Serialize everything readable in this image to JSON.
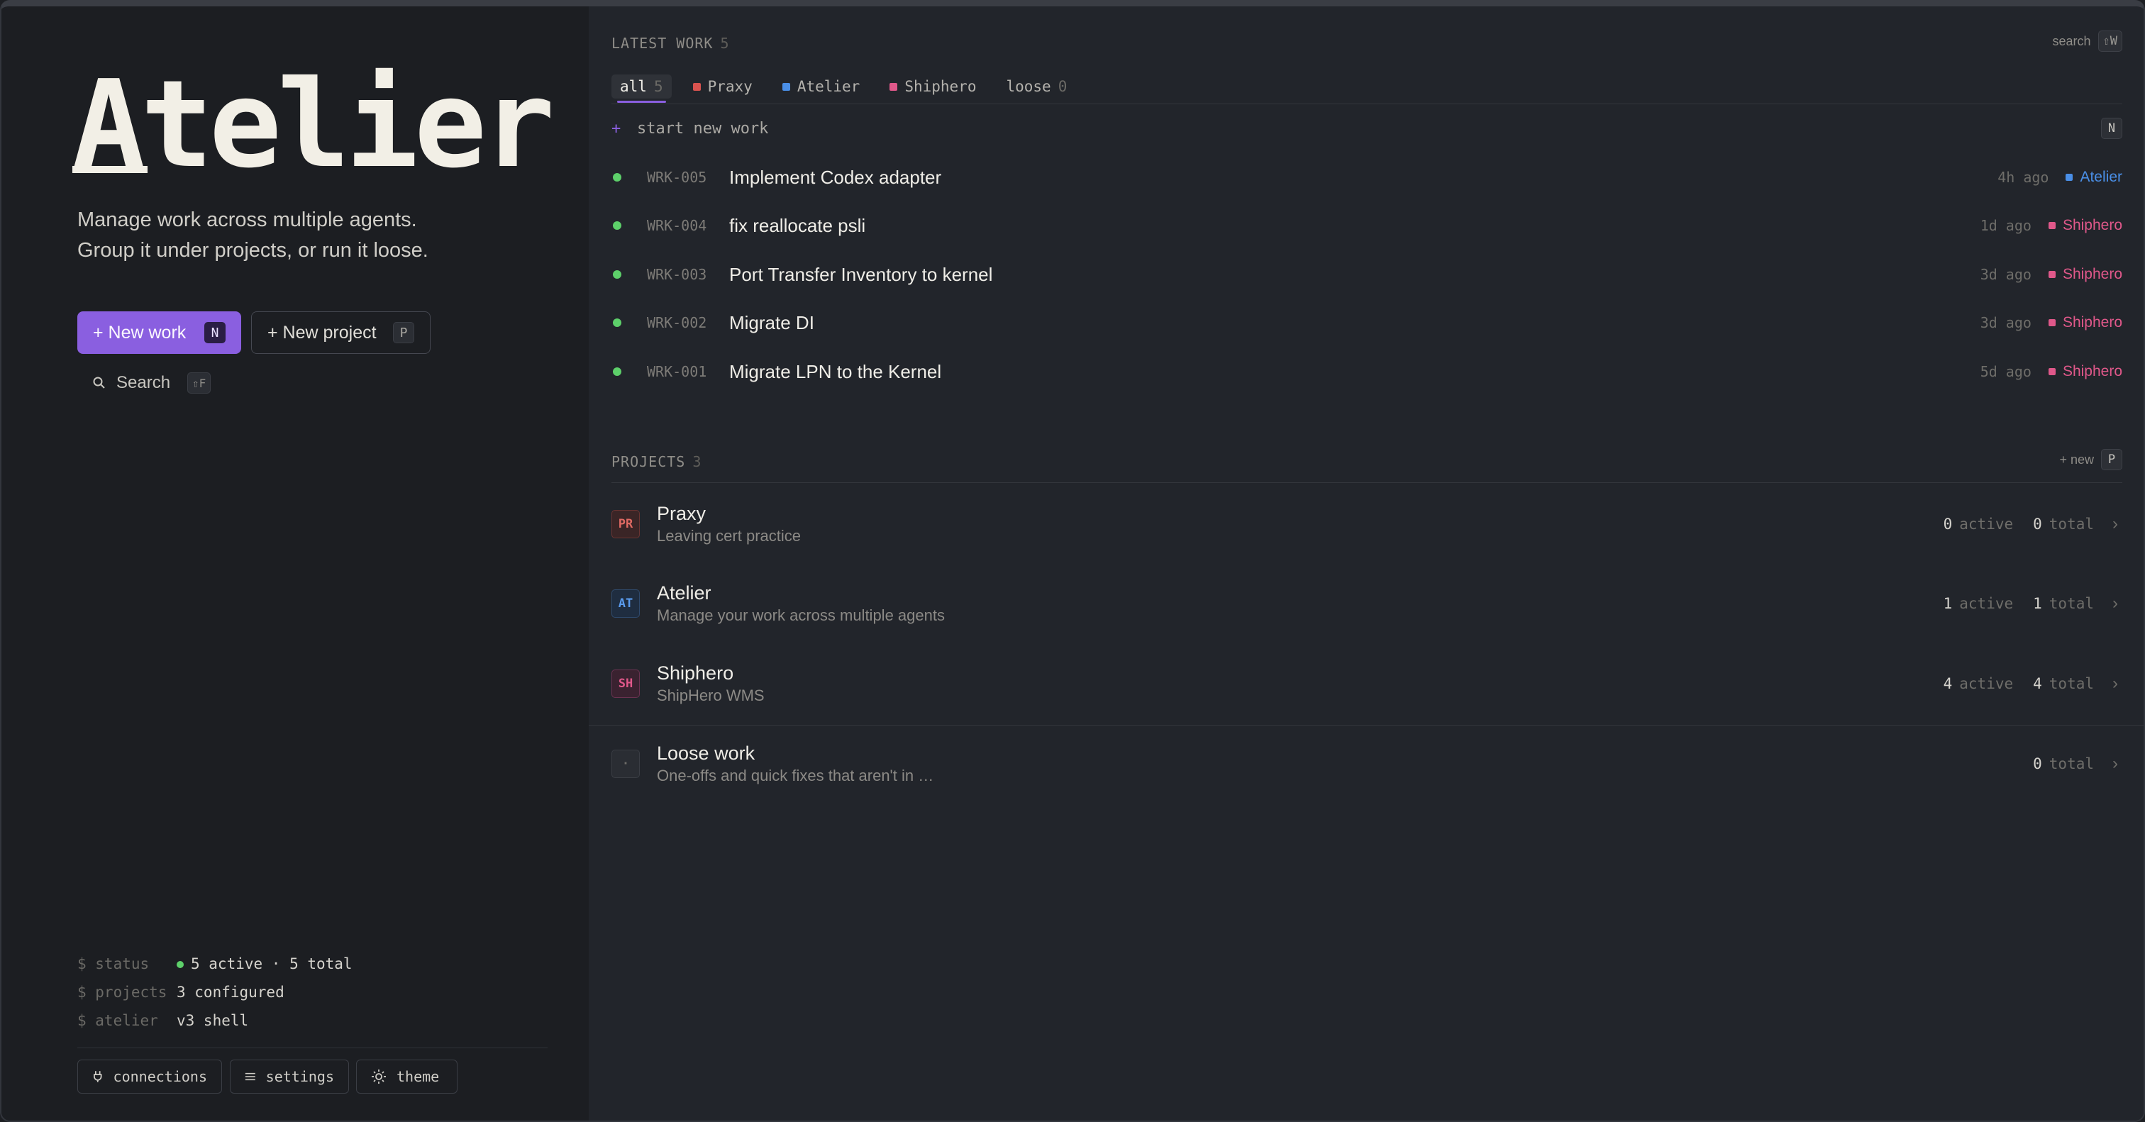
{
  "brand": {
    "logo": "Atelier",
    "tagline_line1": "Manage work across multiple agents.",
    "tagline_line2": "Group it under projects, or run it loose."
  },
  "actions": {
    "new_work_label": "+ New work",
    "new_work_key": "N",
    "new_project_label": "+ New project",
    "new_project_key": "P",
    "search_label": "Search",
    "search_key": "⇧F"
  },
  "status": {
    "status_key": "$ status",
    "status_val": "5 active · 5 total",
    "projects_key": "$ projects",
    "projects_val": "3 configured",
    "atelier_key": "$ atelier",
    "atelier_val": "v3 shell"
  },
  "footer": {
    "connections": "connections",
    "settings": "settings",
    "theme": "theme"
  },
  "latest_work": {
    "label": "LATEST WORK",
    "count": "5",
    "search_label": "search",
    "search_key": "⇧W",
    "tabs": [
      {
        "label": "all",
        "count": "5",
        "active": true,
        "color": ""
      },
      {
        "label": "Praxy",
        "count": "",
        "active": false,
        "color": "#d9534f"
      },
      {
        "label": "Atelier",
        "count": "",
        "active": false,
        "color": "#4a8fe7"
      },
      {
        "label": "Shiphero",
        "count": "",
        "active": false,
        "color": "#e0588a"
      },
      {
        "label": "loose",
        "count": "0",
        "active": false,
        "color": ""
      }
    ],
    "new_work_placeholder": "start new work",
    "new_work_plus": "+",
    "new_work_key": "N",
    "items": [
      {
        "id": "WRK-005",
        "title": "Implement Codex adapter",
        "ago": "4h ago",
        "project": "Atelier",
        "color": "#4a8fe7"
      },
      {
        "id": "WRK-004",
        "title": "fix reallocate psli",
        "ago": "1d ago",
        "project": "Shiphero",
        "color": "#e0588a"
      },
      {
        "id": "WRK-003",
        "title": "Port Transfer Inventory to kernel",
        "ago": "3d ago",
        "project": "Shiphero",
        "color": "#e0588a"
      },
      {
        "id": "WRK-002",
        "title": "Migrate DI",
        "ago": "3d ago",
        "project": "Shiphero",
        "color": "#e0588a"
      },
      {
        "id": "WRK-001",
        "title": "Migrate LPN to the Kernel",
        "ago": "5d ago",
        "project": "Shiphero",
        "color": "#e0588a"
      }
    ]
  },
  "projects": {
    "label": "PROJECTS",
    "count": "3",
    "new_label": "+ new",
    "new_key": "P",
    "items": [
      {
        "badge": "PR",
        "name": "Praxy",
        "desc": "Leaving cert practice",
        "active": "0",
        "active_label": "active",
        "total": "0",
        "total_label": "total",
        "color": "#d9534f"
      },
      {
        "badge": "AT",
        "name": "Atelier",
        "desc": "Manage your work across multiple agents",
        "active": "1",
        "active_label": "active",
        "total": "1",
        "total_label": "total",
        "color": "#4a8fe7"
      },
      {
        "badge": "SH",
        "name": "Shiphero",
        "desc": "ShipHero WMS",
        "active": "4",
        "active_label": "active",
        "total": "4",
        "total_label": "total",
        "color": "#e0588a"
      }
    ],
    "loose": {
      "badge": "·",
      "name": "Loose work",
      "desc": "One-offs and quick fixes that aren't in …",
      "total": "0",
      "total_label": "total"
    }
  }
}
